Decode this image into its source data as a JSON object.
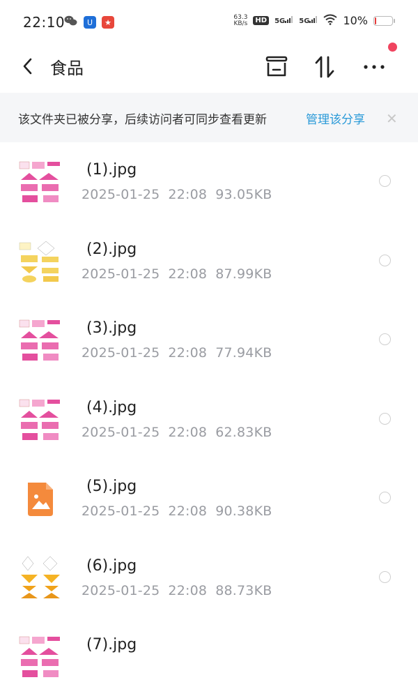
{
  "status_bar": {
    "time": "22:10",
    "net_speed_value": "63.3",
    "net_speed_unit": "KB/s",
    "hd_label": "HD",
    "signal1": "5G",
    "signal2": "5G",
    "battery_text": "10%",
    "battery_level": 0.1,
    "colors": {
      "battery_low": "#e53b3b"
    }
  },
  "header": {
    "title": "食品",
    "icons": [
      "back-icon",
      "archive-icon",
      "sort-icon",
      "more-icon"
    ],
    "notification_dot_color": "#f0445f"
  },
  "banner": {
    "text": "该文件夹已被分享，后续访问者可同步查看更新",
    "link": "管理该分享",
    "link_color": "#2a9ad8"
  },
  "files": [
    {
      "name": "(1).jpg",
      "date": "2025-01-25",
      "time": "22:08",
      "size": "93.05KB",
      "thumb": "pink"
    },
    {
      "name": "(2).jpg",
      "date": "2025-01-25",
      "time": "22:08",
      "size": "87.99KB",
      "thumb": "yellow"
    },
    {
      "name": "(3).jpg",
      "date": "2025-01-25",
      "time": "22:08",
      "size": "77.94KB",
      "thumb": "pink"
    },
    {
      "name": "(4).jpg",
      "date": "2025-01-25",
      "time": "22:08",
      "size": "62.83KB",
      "thumb": "pink"
    },
    {
      "name": "(5).jpg",
      "date": "2025-01-25",
      "time": "22:08",
      "size": "90.38KB",
      "thumb": "placeholder"
    },
    {
      "name": "(6).jpg",
      "date": "2025-01-25",
      "time": "22:08",
      "size": "88.73KB",
      "thumb": "orange"
    },
    {
      "name": "(7).jpg",
      "date": "",
      "time": "",
      "size": "",
      "thumb": "pink"
    }
  ]
}
